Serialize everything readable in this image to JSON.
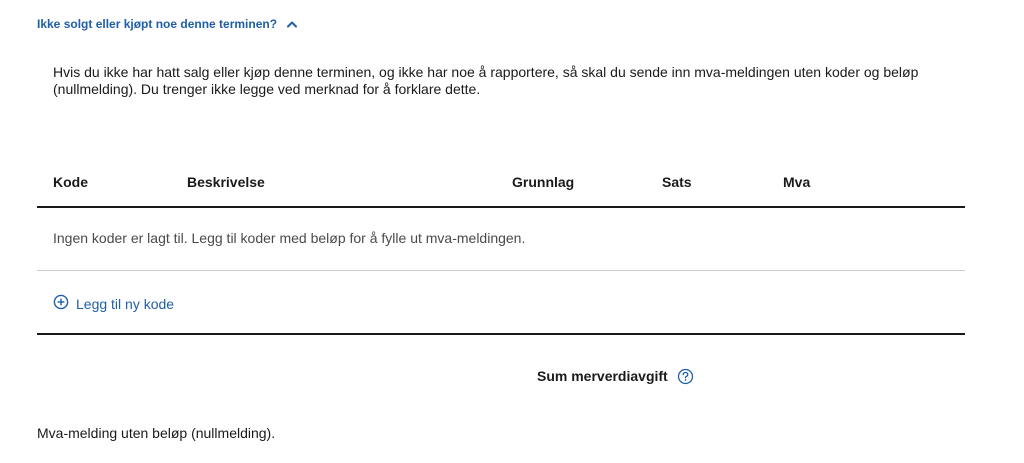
{
  "toggle": {
    "label": "Ikke solgt eller kjøpt noe denne terminen?",
    "expanded": true
  },
  "info": {
    "text": "Hvis du ikke har hatt salg eller kjøp denne terminen, og ikke har noe å rapportere, så skal du sende inn mva-meldingen uten koder og beløp (nullmelding). Du trenger ikke legge ved merknad for å forklare dette."
  },
  "table": {
    "headers": {
      "kode": "Kode",
      "beskrivelse": "Beskrivelse",
      "grunnlag": "Grunnlag",
      "sats": "Sats",
      "mva": "Mva"
    },
    "empty_message": "Ingen koder er lagt til. Legg til koder med beløp for å fylle ut mva-meldingen.",
    "add_label": "Legg til ny kode"
  },
  "sum": {
    "label": "Sum merverdiavgift"
  },
  "footer": {
    "text": "Mva-melding uten beløp (nullmelding)."
  },
  "colors": {
    "link": "#1f5fa8",
    "text": "#1a1a1a",
    "muted": "#4a4a4a",
    "divider": "#cccccc"
  },
  "icons": {
    "toggle": "chevron-up-icon",
    "add": "plus-circle-icon",
    "help": "question-circle-icon"
  }
}
